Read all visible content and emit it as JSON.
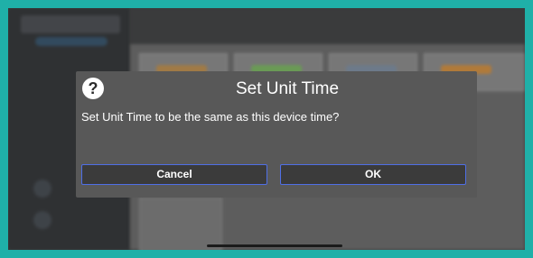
{
  "dialog": {
    "help_glyph": "?",
    "title": "Set Unit Time",
    "message": "Set Unit Time to be the same as this device time?",
    "cancel_label": "Cancel",
    "ok_label": "OK",
    "icon": "help-icon"
  },
  "colors": {
    "frame": "#1fb0a8",
    "dialog_bg": "#585858",
    "button_border": "#4f6fe6",
    "text": "#ffffff"
  }
}
